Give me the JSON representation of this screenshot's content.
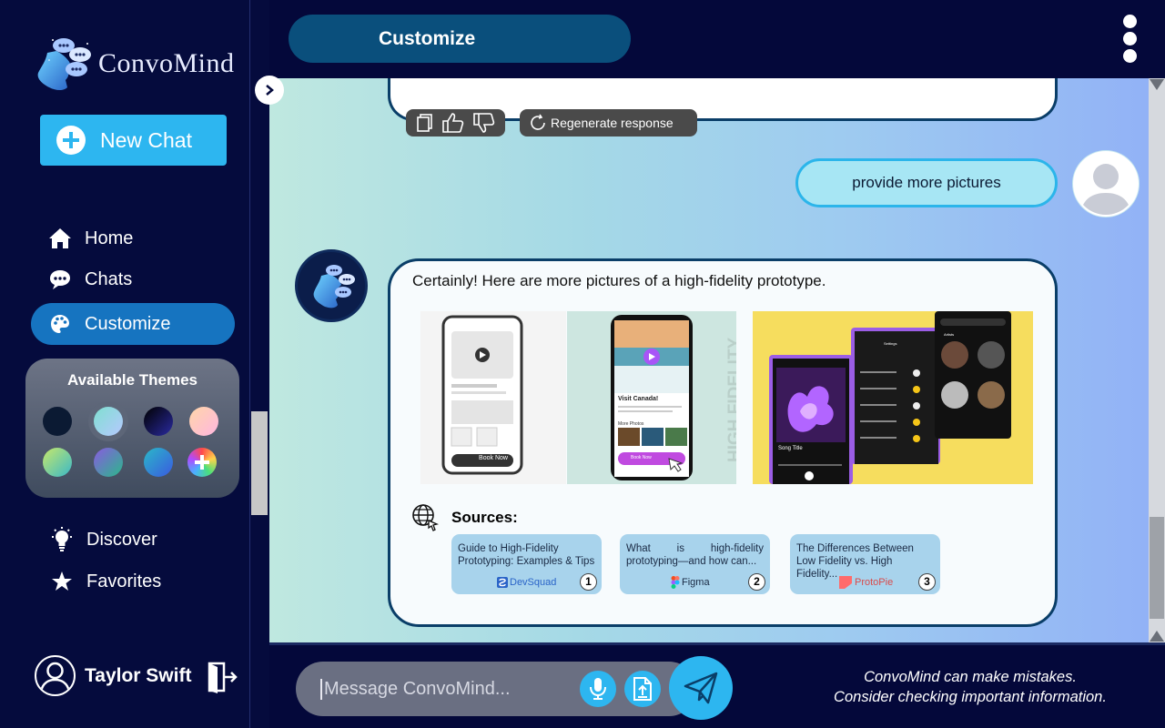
{
  "app": {
    "name": "ConvoMind"
  },
  "sidebar": {
    "new_chat_label": "New Chat",
    "nav": [
      {
        "label": "Home",
        "icon": "home-icon"
      },
      {
        "label": "Chats",
        "icon": "chat-bubble-icon"
      },
      {
        "label": "Customize",
        "icon": "palette-icon",
        "active": true
      },
      {
        "label": "Discover",
        "icon": "lightbulb-icon"
      },
      {
        "label": "Favorites",
        "icon": "star-icon"
      }
    ],
    "themes_title": "Available Themes",
    "user_name": "Taylor Swift"
  },
  "header": {
    "title": "Customize"
  },
  "chat": {
    "actions": {
      "regenerate_label": "Regenerate response"
    },
    "user_message": "provide more pictures",
    "bot_message": "Certainly! Here are more pictures of a high-fidelity prototype.",
    "sources_label": "Sources:",
    "sources": [
      {
        "title": "Guide to High-Fidelity Prototyping: Examples & Tips",
        "brand": "DevSquad",
        "num": "1"
      },
      {
        "title": "What is high-fidelity prototyping—and how can...",
        "brand": "Figma",
        "num": "2"
      },
      {
        "title": "The Differences Between Low Fidelity vs. High Fidelity...",
        "brand": "ProtoPie",
        "num": "3"
      }
    ],
    "images": {
      "mock1_button": "Book Now",
      "mock2_title": "Visit Canada!",
      "mock2_subtitle": "More Photos",
      "mock2_button": "Book Now",
      "mock2_vertical_text": "HIGH FIDELITY",
      "mock3_song": "Song Title",
      "mock3_settings": "Settings",
      "mock3_artists": "Artists"
    }
  },
  "input": {
    "placeholder": "Message ConvoMind..."
  },
  "disclaimer": {
    "line1": "ConvoMind can make mistakes.",
    "line2": "Consider checking important information."
  },
  "colors": {
    "accent": "#2db6f0",
    "sidebar_bg": "#050b3d",
    "active_nav": "#1674c0",
    "bubble_border": "#0a3e68"
  }
}
